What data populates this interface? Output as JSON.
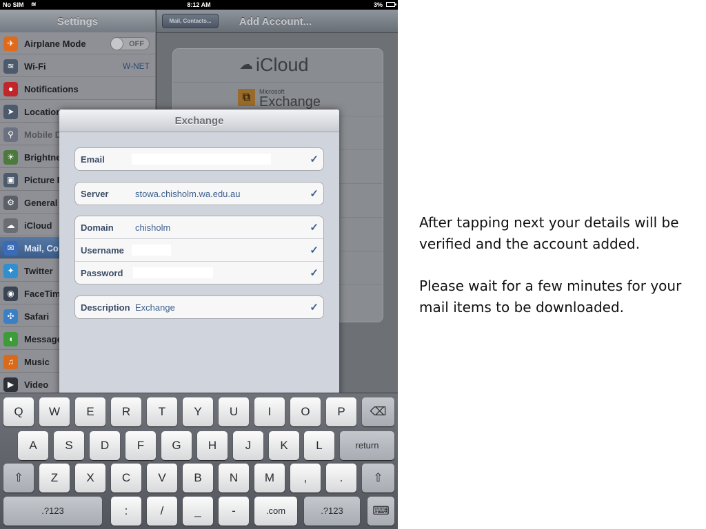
{
  "status_bar": {
    "carrier": "No SIM",
    "time": "8:12 AM",
    "battery": "3%"
  },
  "settings": {
    "title": "Settings",
    "items": [
      {
        "label": "Airplane Mode",
        "toggle": "OFF",
        "icon": "airplane-icon",
        "color": "#e06a1b"
      },
      {
        "label": "Wi-Fi",
        "value": "W-NET",
        "icon": "wifi-icon",
        "color": "#4d5a6b"
      },
      {
        "label": "Notifications",
        "icon": "notifications-icon",
        "color": "#c0262a"
      },
      {
        "label": "Location",
        "icon": "location-icon",
        "color": "#4d5a6b"
      },
      {
        "label": "Mobile D",
        "icon": "mobile-data-icon",
        "color": "#6b7180",
        "dim": true
      },
      {
        "label": "Brightne",
        "icon": "brightness-icon",
        "color": "#4c7a3d"
      },
      {
        "label": "Picture F",
        "icon": "picture-frame-icon",
        "color": "#4d5a6b"
      },
      {
        "label": "General",
        "icon": "general-gear-icon",
        "color": "#5b6068"
      },
      {
        "label": "iCloud",
        "icon": "icloud-icon",
        "color": "#6a6e74"
      },
      {
        "label": "Mail, Co",
        "icon": "mail-icon",
        "color": "#3a6bb4",
        "selected": true
      },
      {
        "label": "Twitter",
        "icon": "twitter-icon",
        "color": "#2f8fd0"
      },
      {
        "label": "FaceTim",
        "icon": "facetime-icon",
        "color": "#3b4552"
      },
      {
        "label": "Safari",
        "icon": "safari-icon",
        "color": "#3b7fc4"
      },
      {
        "label": "Message",
        "icon": "messages-icon",
        "color": "#3e9b3a"
      },
      {
        "label": "Music",
        "icon": "music-icon",
        "color": "#d86a1a"
      },
      {
        "label": "Video",
        "icon": "video-icon",
        "color": "#2f3138"
      }
    ]
  },
  "account": {
    "back_label": "Mail, Contacts...",
    "title": "Add Account...",
    "providers": [
      {
        "name": "iCloud",
        "icon": "icloud-cloud-icon"
      },
      {
        "brand_small": "Microsoft",
        "name": "Exchange",
        "icon": "exchange-icon"
      }
    ]
  },
  "exchange_sheet": {
    "title": "Exchange",
    "groups": [
      [
        {
          "label": "Email",
          "value": ""
        }
      ],
      [
        {
          "label": "Server",
          "value": "stowa.chisholm.wa.edu.au"
        }
      ],
      [
        {
          "label": "Domain",
          "value": "chisholm"
        },
        {
          "label": "Username",
          "value": ""
        },
        {
          "label": "Password",
          "value": ""
        }
      ],
      [
        {
          "label": "Description",
          "value": "Exchange"
        }
      ]
    ],
    "check": "✓"
  },
  "keyboard": {
    "row1": [
      "Q",
      "W",
      "E",
      "R",
      "T",
      "Y",
      "U",
      "I",
      "O",
      "P",
      "⌫"
    ],
    "row2": [
      "A",
      "S",
      "D",
      "F",
      "G",
      "H",
      "J",
      "K",
      "L",
      "return"
    ],
    "row3": [
      "⇧",
      "Z",
      "X",
      "C",
      "V",
      "B",
      "N",
      "M",
      ",",
      ".",
      "⇧"
    ],
    "row4": [
      ".?123",
      ":",
      "/",
      "_",
      "-",
      ".com",
      ".?123",
      "⌨"
    ]
  },
  "slide_text": {
    "paragraph1": "After tapping next your details will be verified and the account added.",
    "paragraph2": "Please wait for a few minutes for your mail items to be downloaded."
  }
}
